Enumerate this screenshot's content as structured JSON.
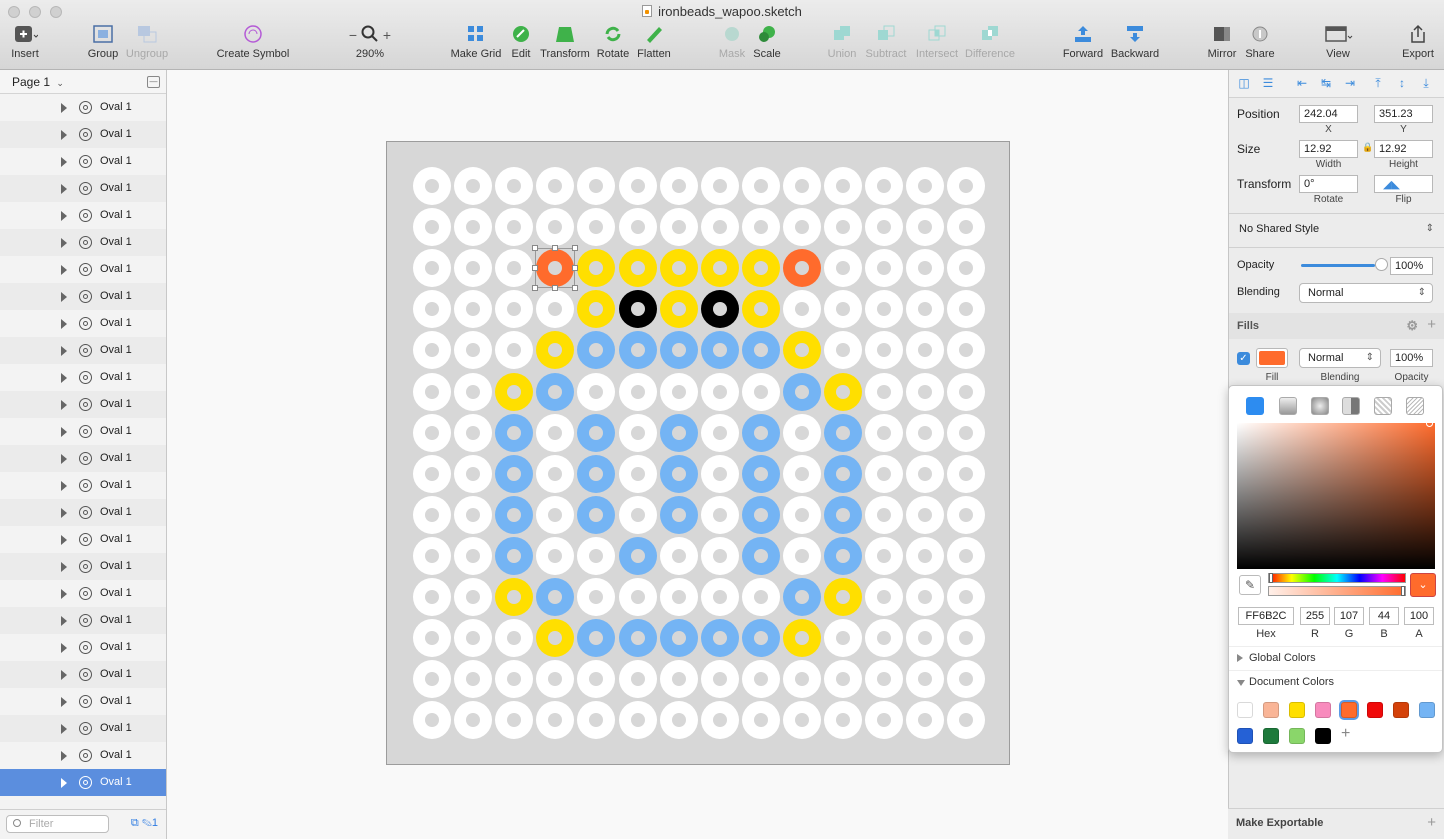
{
  "window": {
    "title": "ironbeads_wapoo.sketch"
  },
  "toolbar": {
    "insert": "Insert",
    "group": "Group",
    "ungroup": "Ungroup",
    "create_symbol": "Create Symbol",
    "zoom_minus": "−",
    "zoom_plus": "+",
    "zoom": "290%",
    "make_grid": "Make Grid",
    "edit": "Edit",
    "transform": "Transform",
    "rotate": "Rotate",
    "flatten": "Flatten",
    "mask": "Mask",
    "scale": "Scale",
    "union": "Union",
    "subtract": "Subtract",
    "intersect": "Intersect",
    "difference": "Difference",
    "forward": "Forward",
    "backward": "Backward",
    "mirror": "Mirror",
    "share": "Share",
    "view": "View",
    "export": "Export"
  },
  "left_panel": {
    "page": "Page 1",
    "layers": [
      "Oval 1",
      "Oval 1",
      "Oval 1",
      "Oval 1",
      "Oval 1",
      "Oval 1",
      "Oval 1",
      "Oval 1",
      "Oval 1",
      "Oval 1",
      "Oval 1",
      "Oval 1",
      "Oval 1",
      "Oval 1",
      "Oval 1",
      "Oval 1",
      "Oval 1",
      "Oval 1",
      "Oval 1",
      "Oval 1",
      "Oval 1",
      "Oval 1",
      "Oval 1",
      "Oval 1",
      "Oval 1",
      "Oval 1"
    ],
    "selected_index": 25,
    "filter_placeholder": "Filter",
    "count": "1"
  },
  "canvas": {
    "colors": {
      "w": "#ffffff",
      "y": "#ffdf00",
      "o": "#ff6b2c",
      "k": "#000000",
      "b": "#74b4f4"
    },
    "grid": [
      "wwwwwwwwwwwwww",
      "wwwwwwwwwwwwww",
      "wwwoyyyyyowwww",
      "wwwwykykywwwww",
      "wwwybbbbbywwww",
      "wwybwwwwwbywww",
      "wwbwbwbwbwbwww",
      "wwbwbwbwbwbwww",
      "wwbwbwbwbwbwww",
      "wwbwwbwwbwbwww",
      "wwybwwwwwbywww",
      "wwwybbbbbywwww",
      "wwwwwwwwwwwwww",
      "wwwwwwwwwwwwww"
    ],
    "selected_cell": [
      2,
      3
    ]
  },
  "inspector": {
    "position_label": "Position",
    "x": "242.04",
    "x_label": "X",
    "y": "351.23",
    "y_label": "Y",
    "size_label": "Size",
    "width": "12.92",
    "width_label": "Width",
    "height": "12.92",
    "height_label": "Height",
    "transform_label": "Transform",
    "rotate": "0°",
    "rotate_label": "Rotate",
    "flip_label": "Flip",
    "shared_style": "No Shared Style",
    "opacity_label": "Opacity",
    "opacity": "100%",
    "opacity_fraction": 1.0,
    "blending_label": "Blending",
    "blending": "Normal",
    "fills_label": "Fills",
    "fill_blending": "Normal",
    "fill_opacity": "100%",
    "fill_sub": "Fill",
    "fill_blending_sub": "Blending",
    "fill_opacity_sub": "Opacity",
    "fill_color": "#ff6b2c",
    "make_exportable": "Make Exportable"
  },
  "color_picker": {
    "hex": "FF6B2C",
    "r": "255",
    "g": "107",
    "b": "44",
    "a": "100",
    "labels": {
      "hex": "Hex",
      "r": "R",
      "g": "G",
      "b": "B",
      "a": "A"
    },
    "global_colors": "Global Colors",
    "document_colors": "Document Colors",
    "swatches": [
      "#ffffff",
      "#f9b597",
      "#ffdf00",
      "#f88bbd",
      "#ff6b2c",
      "#f00a0a",
      "#d4420a",
      "#74b4f4",
      "#2561d6",
      "#1e7a3c",
      "#8ad66a",
      "#000000"
    ],
    "active_swatch": 4
  }
}
